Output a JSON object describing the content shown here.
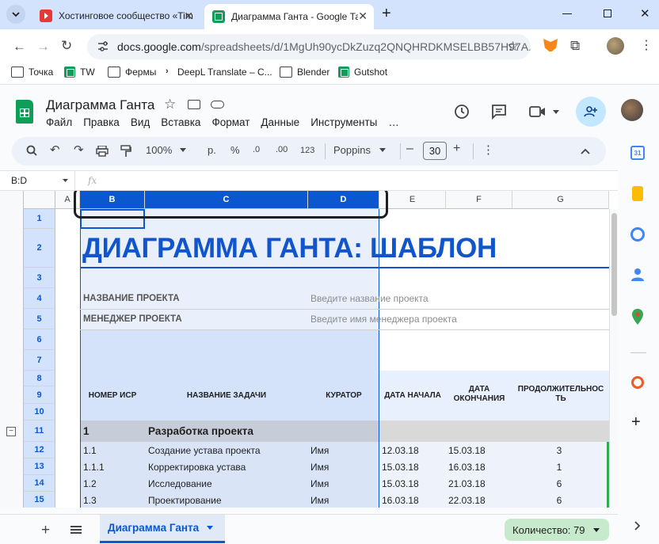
{
  "browser": {
    "tabs": [
      {
        "title": "Хостинговое сообщество «Tim",
        "active": false
      },
      {
        "title": "Диаграмма Ганта - Google Таб",
        "active": true
      }
    ],
    "new_tab": "+",
    "url_host": "docs.google.com",
    "url_path": "/spreadsheets/d/1MgUh90ycDkZuzq2QNQHRDKMSELBB57H97A...",
    "bookmarks": [
      "Точка",
      "TW",
      "Фермы",
      "DeepL Translate – C...",
      "Blender",
      "Gutshot"
    ]
  },
  "doc": {
    "title": "Диаграмма Ганта",
    "menu": [
      "Файл",
      "Правка",
      "Вид",
      "Вставка",
      "Формат",
      "Данные",
      "Инструменты",
      "…"
    ]
  },
  "format_bar": {
    "zoom": "100%",
    "currency": "р.",
    "percent": "%",
    "dec_decrease": ".0",
    "dec_increase": ".00",
    "number_format": "123",
    "font": "Poppins",
    "font_size": "30",
    "minus": "–",
    "plus": "+"
  },
  "formula_bar": {
    "name_box": "B:D",
    "fx": "fx"
  },
  "columns": [
    "A",
    "B",
    "C",
    "D",
    "E",
    "F",
    "G"
  ],
  "rows": [
    "1",
    "2",
    "3",
    "4",
    "5",
    "6",
    "7",
    "8",
    "9",
    "10",
    "11",
    "12",
    "13",
    "14",
    "15"
  ],
  "sheet": {
    "big_title": "ДИАГРАММА ГАНТА: ШАБЛОН",
    "project_name_label": "НАЗВАНИЕ ПРОЕКТА",
    "project_name_placeholder": "Введите название проекта",
    "manager_label": "МЕНЕДЖЕР ПРОЕКТА",
    "manager_placeholder": "Введите имя менеджера проекта",
    "headers": [
      "НОМЕР ИСР",
      "НАЗВАНИЕ ЗАДАЧИ",
      "КУРАТОР",
      "ДАТА НАЧАЛА",
      "ДАТА ОКОНЧАНИЯ",
      "ПРОДОЛЖИТЕЛЬНОСТЬ"
    ],
    "group_row": {
      "wbs": "1",
      "name": "Разработка проекта"
    },
    "tasks": [
      {
        "wbs": "1.1",
        "name": "Создание устава проекта",
        "owner": "Имя",
        "start": "12.03.18",
        "end": "15.03.18",
        "dur": "3"
      },
      {
        "wbs": "1.1.1",
        "name": "Корректировка устава",
        "owner": "Имя",
        "start": "15.03.18",
        "end": "16.03.18",
        "dur": "1"
      },
      {
        "wbs": "1.2",
        "name": "Исследование",
        "owner": "Имя",
        "start": "15.03.18",
        "end": "21.03.18",
        "dur": "6"
      },
      {
        "wbs": "1.3",
        "name": "Проектирование",
        "owner": "Имя",
        "start": "16.03.18",
        "end": "22.03.18",
        "dur": "6"
      }
    ]
  },
  "sheet_tabs": {
    "add": "+",
    "active_tab": "Диаграмма Ганта",
    "count_label": "Количество: 79"
  },
  "colors": {
    "accent": "#0b57d0",
    "title_blue": "#1155cc",
    "header_band": "#e8f0fe",
    "group_row": "#d9d9d9"
  }
}
